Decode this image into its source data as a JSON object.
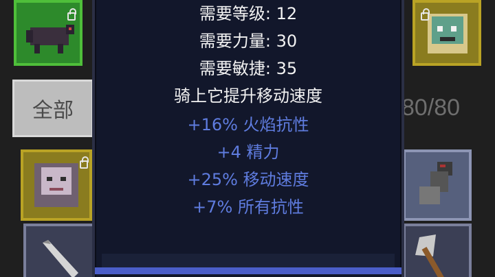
{
  "filter": {
    "tab_label": "全部"
  },
  "inventory": {
    "count_text": "80/80"
  },
  "tooltip": {
    "requirements": [
      {
        "label": "需要等级: 12"
      },
      {
        "label": "需要力量: 30"
      },
      {
        "label": "需要敏捷: 35"
      }
    ],
    "description": "骑上它提升移动速度",
    "bonuses": [
      "+16% 火焰抗性",
      "+4 精力",
      "+25% 移动速度",
      "+7% 所有抗性"
    ]
  },
  "colors": {
    "requirement_text": "#f2f2f2",
    "bonus_text": "#5f7cdf",
    "tooltip_bg": "#12172b"
  },
  "icons": [
    "lock-icon",
    "mount-beast-icon",
    "skull-pet-icon",
    "armored-glove-icon",
    "sword-icon",
    "axe-icon"
  ]
}
